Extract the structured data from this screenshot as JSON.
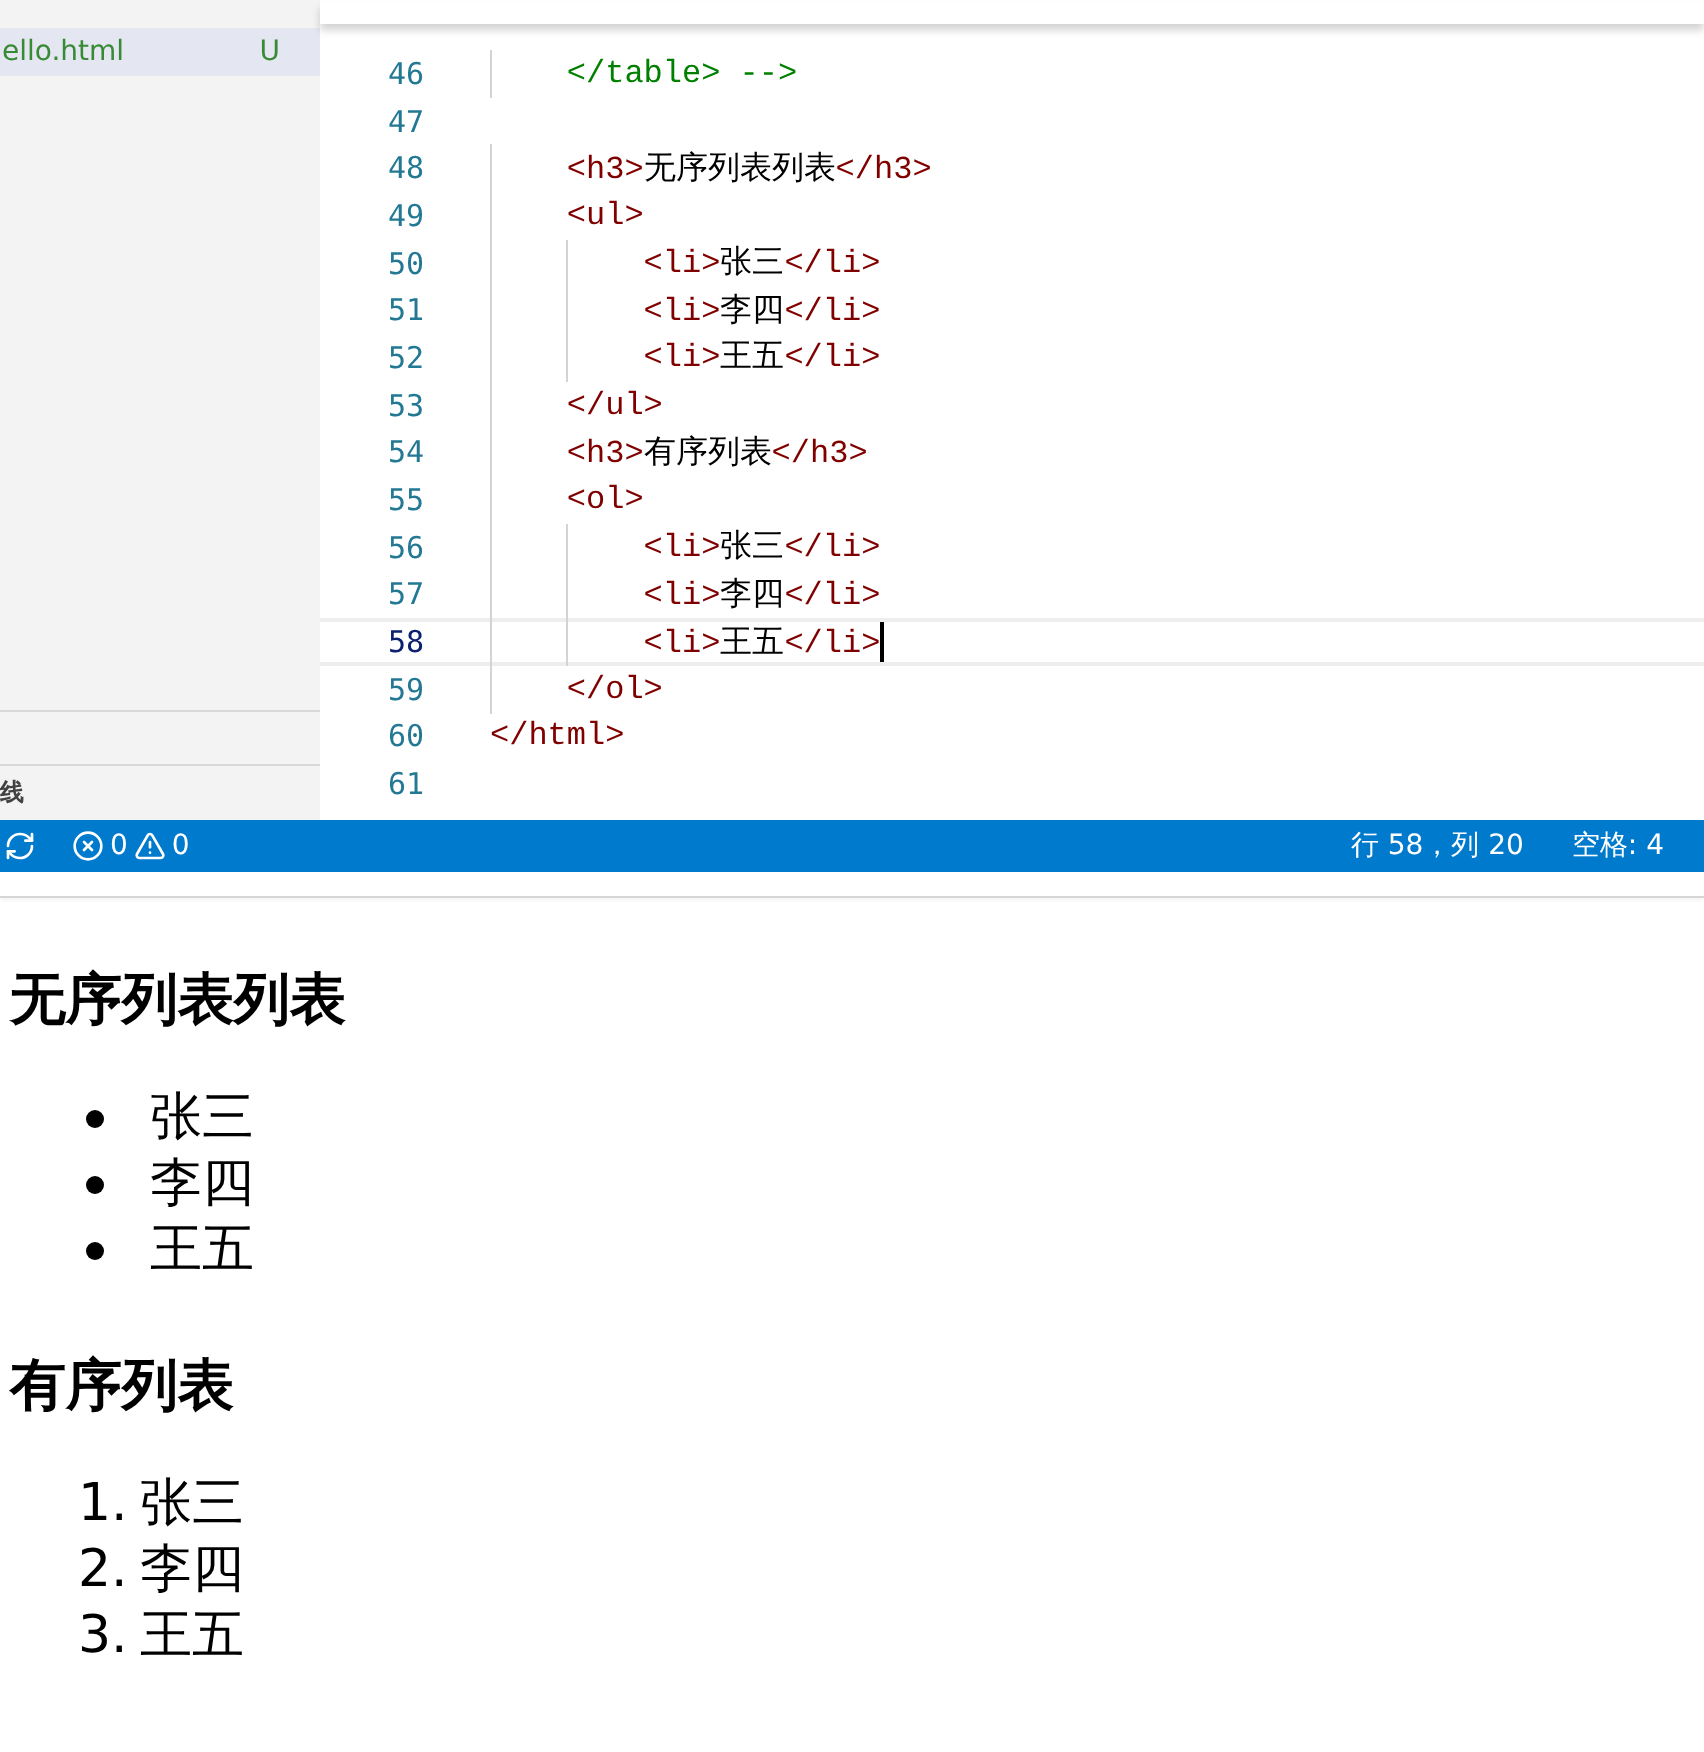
{
  "sidebar": {
    "file": {
      "name": "ello.html",
      "status": "U",
      "selected": true
    },
    "section_label": "线"
  },
  "editor": {
    "lines": [
      {
        "number": "46",
        "text": "    </table> -->",
        "kind": "comment",
        "current": false
      },
      {
        "number": "47",
        "kind": "code",
        "current": false
      },
      {
        "number": "48",
        "text": "    <h3>无序列表列表</h3>",
        "kind": "code",
        "current": false
      },
      {
        "number": "49",
        "text": "    <ul>",
        "kind": "code",
        "current": false
      },
      {
        "number": "50",
        "text": "        <li>张三</li>",
        "kind": "code",
        "current": false
      },
      {
        "number": "51",
        "text": "        <li>李四</li>",
        "kind": "code",
        "current": false
      },
      {
        "number": "52",
        "text": "        <li>王五</li>",
        "kind": "code",
        "current": false
      },
      {
        "number": "53",
        "text": "    </ul>",
        "kind": "code",
        "current": false
      },
      {
        "number": "54",
        "text": "    <h3>有序列表</h3>",
        "kind": "code",
        "current": false
      },
      {
        "number": "55",
        "text": "    <ol>",
        "kind": "code",
        "current": false
      },
      {
        "number": "56",
        "text": "        <li>张三</li>",
        "kind": "code",
        "current": false
      },
      {
        "number": "57",
        "text": "        <li>李四</li>",
        "kind": "code",
        "current": false
      },
      {
        "number": "58",
        "text": "        <li>王五</li>",
        "kind": "code",
        "current": true
      },
      {
        "number": "59",
        "text": "    </ol>",
        "kind": "code",
        "current": false
      },
      {
        "number": "60",
        "text": "</html>",
        "kind": "code",
        "current": false
      },
      {
        "number": "61",
        "kind": "code",
        "current": false
      }
    ]
  },
  "status_bar": {
    "errors": "0",
    "warnings": "0",
    "position": "行 58，列 20",
    "indent": "空格: 4"
  },
  "preview": {
    "sections": [
      {
        "heading": "无序列表列表",
        "kind": "bulleted",
        "items": [
          {
            "text": "张三"
          },
          {
            "text": "李四"
          },
          {
            "text": "王五"
          }
        ]
      },
      {
        "heading": "有序列表",
        "kind": "numbered",
        "items": [
          {
            "marker": "1.",
            "text": "张三"
          },
          {
            "marker": "2.",
            "text": "李四"
          },
          {
            "marker": "3.",
            "text": "王五"
          }
        ]
      }
    ]
  }
}
